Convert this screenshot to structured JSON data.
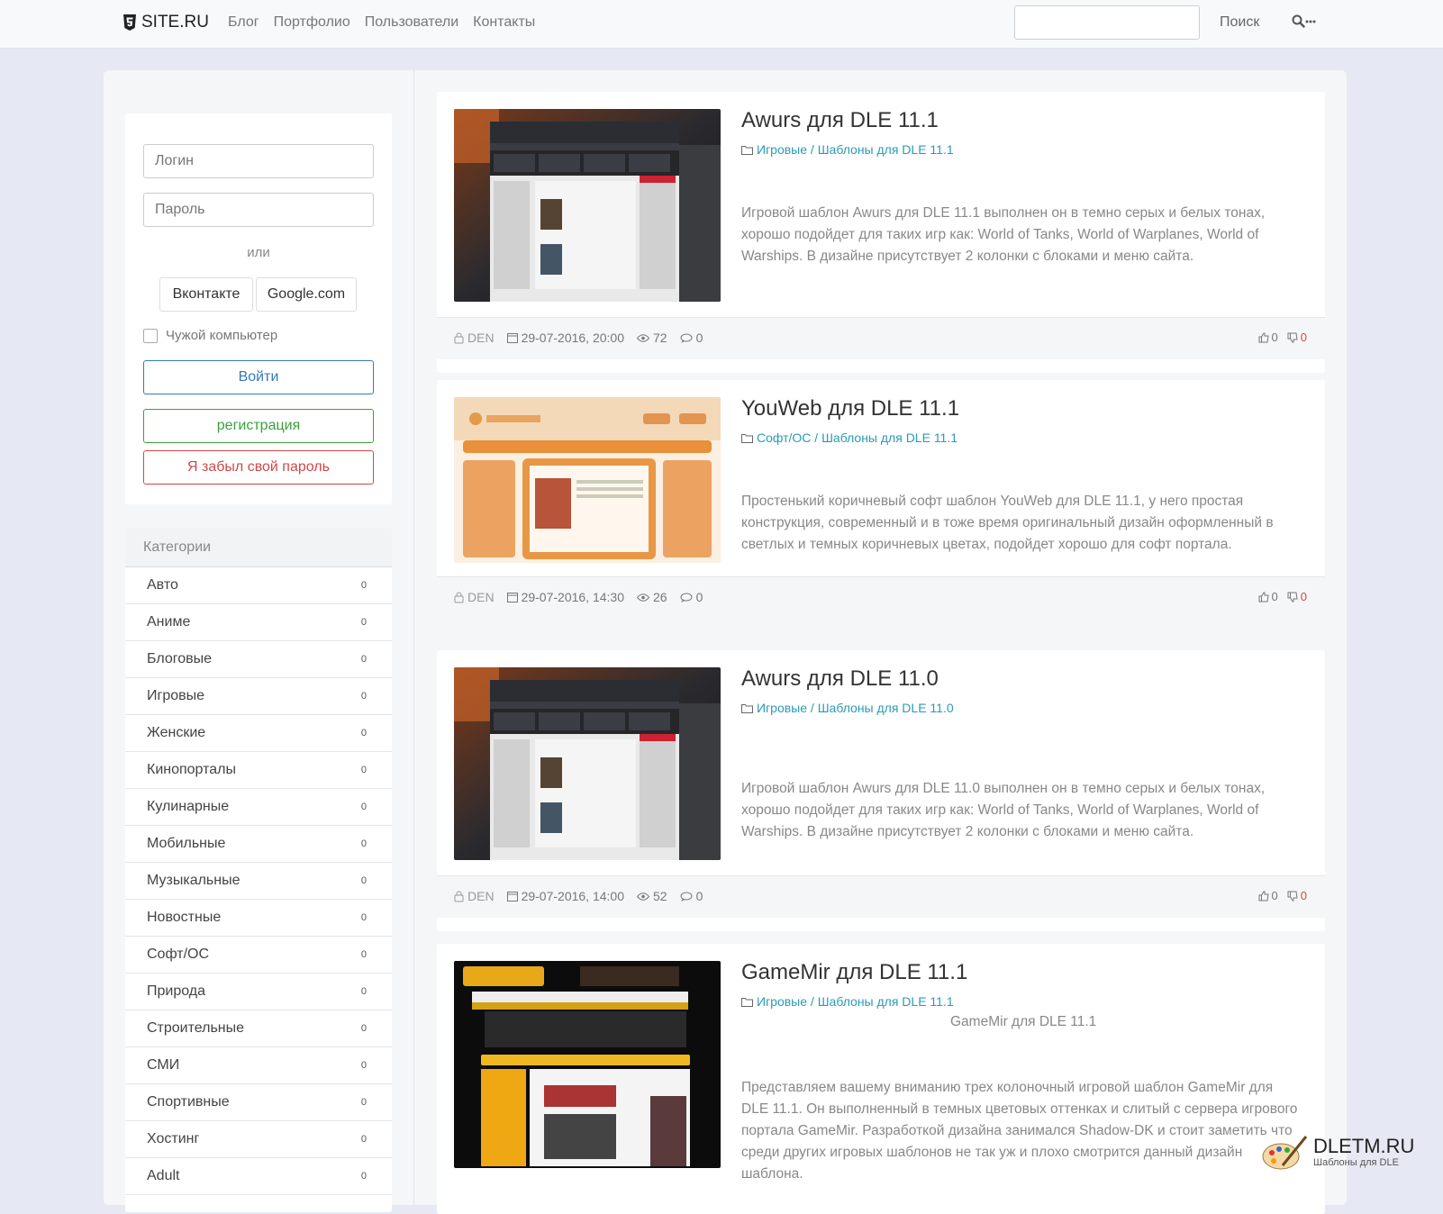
{
  "navbar": {
    "brand": "SITE.RU",
    "links": [
      "Блог",
      "Портфолио",
      "Пользователи",
      "Контакты"
    ],
    "search_placeholder": "",
    "search_button": "Поиск"
  },
  "login": {
    "login_placeholder": "Логин",
    "password_placeholder": "Пароль",
    "or": "или",
    "vk": "Вконтакте",
    "google": "Google.com",
    "foreign_pc": "Чужой компьютер",
    "enter": "Войти",
    "register": "регистрация",
    "forgot": "Я забыл свой пароль"
  },
  "categories": {
    "title": "Категории",
    "items": [
      {
        "label": "Авто",
        "count": "0"
      },
      {
        "label": "Аниме",
        "count": "0"
      },
      {
        "label": "Блоговые",
        "count": "0"
      },
      {
        "label": "Игровые",
        "count": "0"
      },
      {
        "label": "Женские",
        "count": "0"
      },
      {
        "label": "Кинопорталы",
        "count": "0"
      },
      {
        "label": "Кулинарные",
        "count": "0"
      },
      {
        "label": "Мобильные",
        "count": "0"
      },
      {
        "label": "Музыкальные",
        "count": "0"
      },
      {
        "label": "Новостные",
        "count": "0"
      },
      {
        "label": "Софт/ОС",
        "count": "0"
      },
      {
        "label": "Природа",
        "count": "0"
      },
      {
        "label": "Строительные",
        "count": "0"
      },
      {
        "label": "СМИ",
        "count": "0"
      },
      {
        "label": "Спортивные",
        "count": "0"
      },
      {
        "label": "Хостинг",
        "count": "0"
      },
      {
        "label": "Adult",
        "count": "0"
      }
    ]
  },
  "posts": [
    {
      "title": "Awurs для DLE 11.1",
      "category": "Игровые / Шаблоны для DLE 11.1",
      "text": "Игровой шаблон Awurs для DLE 11.1 выполнен он в темно серых и белых тонах, хорошо подойдет для таких игр как: World of Tanks, World of Warplanes, World of Warships. В дизайне присутствует 2 колонки с блоками и меню сайта.",
      "author": "DEN",
      "date": "29-07-2016, 20:00",
      "views": "72",
      "comments": "0",
      "likes": "0",
      "dislikes": "0"
    },
    {
      "title": "YouWeb для DLE 11.1",
      "category": "Софт/ОС / Шаблоны для DLE 11.1",
      "text": "Простенький коричневый софт шаблон YouWeb для DLE 11.1, у него простая конструкция, современный и в тоже время оригинальный дизайн оформленный в светлых и темных коричневых цветах, подойдет хорошо для софт портала.",
      "author": "DEN",
      "date": "29-07-2016, 14:30",
      "views": "26",
      "comments": "0",
      "likes": "0",
      "dislikes": "0"
    },
    {
      "title": "Awurs для DLE 11.0",
      "category": "Игровые / Шаблоны для DLE 11.0",
      "text": "Игровой шаблон Awurs для DLE 11.0 выполнен он в темно серых и белых тонах, хорошо подойдет для таких игр как: World of Tanks, World of Warplanes, World of Warships. В дизайне присутствует 2 колонки с блоками и меню сайта.",
      "author": "DEN",
      "date": "29-07-2016, 14:00",
      "views": "52",
      "comments": "0",
      "likes": "0",
      "dislikes": "0"
    },
    {
      "title": "GameMir для DLE 11.1",
      "category": "Игровые / Шаблоны для DLE 11.1",
      "image_caption": "GameMir для DLE 11.1",
      "text": "Представляем вашему вниманию трех колоночный игровой шаблон GameMir для DLE 11.1. Он выполненный в темных цветовых оттенках и слитый с сервера игрового портала GameMir. Разработкой дизайна занимался Shadow-DK и стоит заметить что среди других игровых шаблонов не так уж и плохо смотрится данный дизайн шаблона."
    }
  ],
  "watermark": {
    "title": "DLETM.RU",
    "subtitle": "Шаблоны для DLE"
  },
  "colors": {
    "link": "#2a9bb5",
    "primary": "#337ab7",
    "success": "#3ca03c",
    "danger": "#d04848",
    "background": "#e6e8f3"
  }
}
